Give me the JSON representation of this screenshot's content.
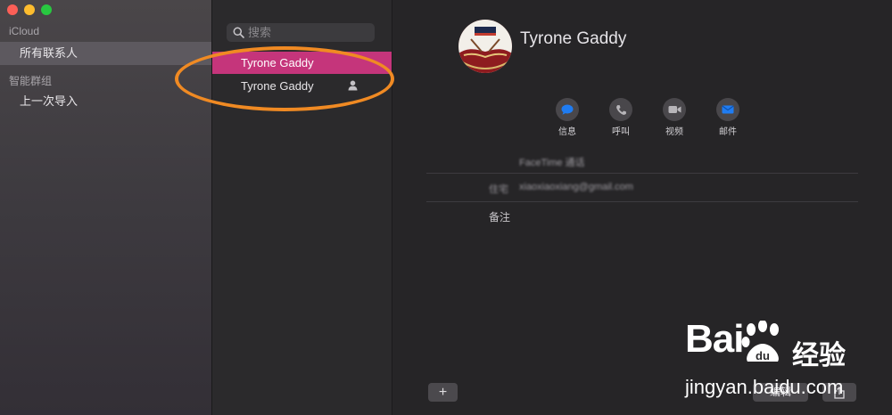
{
  "sidebar": {
    "account_header": "iCloud",
    "all_contacts": "所有联系人",
    "smart_groups_header": "智能群组",
    "last_import": "上一次导入"
  },
  "search": {
    "placeholder": "搜索"
  },
  "contacts": [
    {
      "name": "Tyrone Gaddy",
      "selected": true
    },
    {
      "name": "Tyrone Gaddy",
      "selected": false,
      "icon": "person-icon"
    }
  ],
  "detail": {
    "name": "Tyrone Gaddy",
    "actions": [
      {
        "label": "信息",
        "icon": "message-icon"
      },
      {
        "label": "呼叫",
        "icon": "phone-icon"
      },
      {
        "label": "视频",
        "icon": "video-icon"
      },
      {
        "label": "邮件",
        "icon": "mail-icon"
      }
    ],
    "facetime_label": "FaceTime 通话",
    "email_label": "住宅",
    "email_value": "xiaoxiaoxiang@gmail.com",
    "notes_label": "备注",
    "add_button": "+",
    "edit_button": "编辑"
  },
  "watermark": {
    "brand": "Bai",
    "brand_du": "du",
    "brand_cn": "经验",
    "url": "jingyan.baidu.com"
  },
  "colors": {
    "selection": "#c5357b",
    "annotation": "#f08a23",
    "action_icon": "#1f7cf2"
  }
}
